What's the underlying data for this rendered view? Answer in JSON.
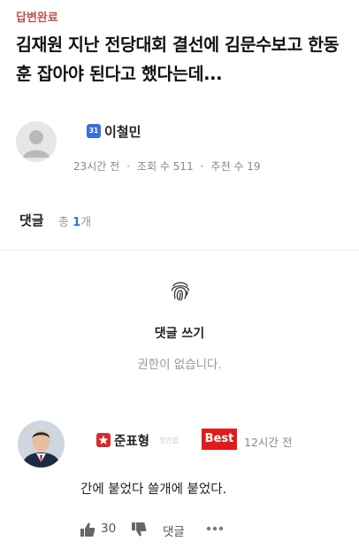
{
  "post": {
    "status_tag": "답변완료",
    "title": "김재원 지난 전당대회 결선에 김문수보고 한동훈 잡아야 된다고 했다는데...",
    "author": {
      "level_badge": "31",
      "name": "이철민",
      "badge_color": "#3a6fd8"
    },
    "meta": {
      "time": "23시간 전",
      "views": "조회 수 511",
      "recommends": "추천 수 19"
    }
  },
  "comments_section": {
    "header": "댓글",
    "count_prefix": "총 ",
    "count": "1",
    "count_suffix": "개",
    "write": {
      "icon": "fingerprint-icon",
      "label": "댓글 쓰기",
      "no_permission": "권한이 없습니다."
    }
  },
  "comment": {
    "author": "준표형",
    "author_sub": "정반합",
    "best_label": "Best",
    "time": "12시간 전",
    "text": "간에 붙었다 쓸개에 붙었다.",
    "likes": "30",
    "reply_label": "댓글",
    "colors": {
      "best": "#e01b1b",
      "badge": "#d62b2b"
    }
  }
}
